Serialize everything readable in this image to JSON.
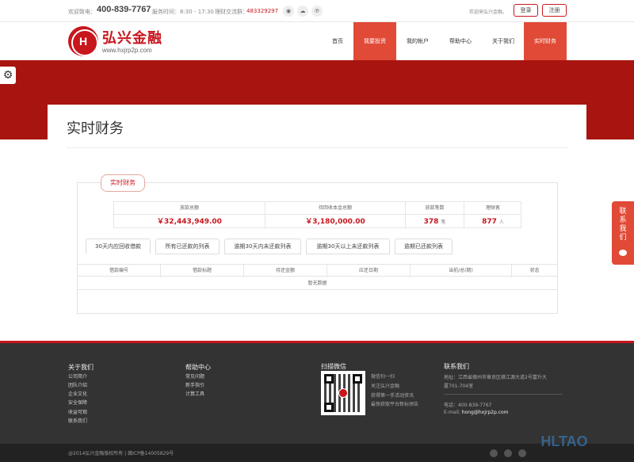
{
  "topbar": {
    "phone_label": "欢迎致电：",
    "phone": "400-839-7767",
    "hours": "服务时间：8:30 - 17:30",
    "qq_label": "理财交流群：",
    "qq": "483329297",
    "welcome": "欢迎来弘兴金融，",
    "login": "登录",
    "register": "注册"
  },
  "logo": {
    "mark": "H",
    "name": "弘兴金融",
    "url": "www.hxjrp2p.com"
  },
  "nav": [
    {
      "label": "首页",
      "active": false
    },
    {
      "label": "我要投资",
      "active": true
    },
    {
      "label": "我的帐户",
      "active": false
    },
    {
      "label": "帮助中心",
      "active": false
    },
    {
      "label": "关于我们",
      "active": false
    },
    {
      "label": "实时财务",
      "active": true
    }
  ],
  "page": {
    "title": "实时财务",
    "section_tab": "实时财务"
  },
  "stats": [
    {
      "label": "放款总额",
      "value": "￥32,443,949.00",
      "unit": ""
    },
    {
      "label": "待回收本金总额",
      "value": "￥3,180,000.00",
      "unit": ""
    },
    {
      "label": "放款笔数",
      "value": "378",
      "unit": "笔"
    },
    {
      "label": "理财客",
      "value": "877",
      "unit": "人"
    }
  ],
  "tabs": [
    "30天内应回收借款",
    "所有已还款的列表",
    "逾期30天内未还款列表",
    "逾期30天以上未还款列表",
    "逾期已还款列表"
  ],
  "table": {
    "columns": [
      "借款编号",
      "借款标题",
      "待还金额",
      "应还日期",
      "当前/总(期)",
      "状态"
    ],
    "empty": "暂无数据"
  },
  "contact_widget": {
    "chars": [
      "联",
      "系",
      "我",
      "们"
    ]
  },
  "footer": {
    "about": {
      "title": "关于我们",
      "links": [
        "公司简介",
        "团队介绍",
        "企业文化",
        "安全保障",
        "收益可观",
        "联系我们"
      ]
    },
    "help": {
      "title": "帮助中心",
      "links": [
        "常见问题",
        "新手指引",
        "计算工具"
      ]
    },
    "wechat": {
      "title": "扫描微信",
      "lines": [
        "微信扫一扫",
        "关注弘兴金融",
        "获得第一手活动资讯",
        "最快获取平台新标预告"
      ]
    },
    "contact": {
      "title": "联系我们",
      "address_1": "地址：江西省赣州市章贡区赣江源大道2号富升大",
      "address_2": "厦701-704室",
      "phone": "电话：400-839-7767",
      "email_label": "E-mail: ",
      "email": "hong@hxjrp2p.com"
    },
    "copyright": "@2014弘兴金融版权所有 | 赣ICP备14005829号"
  },
  "watermark": "HLTAO"
}
